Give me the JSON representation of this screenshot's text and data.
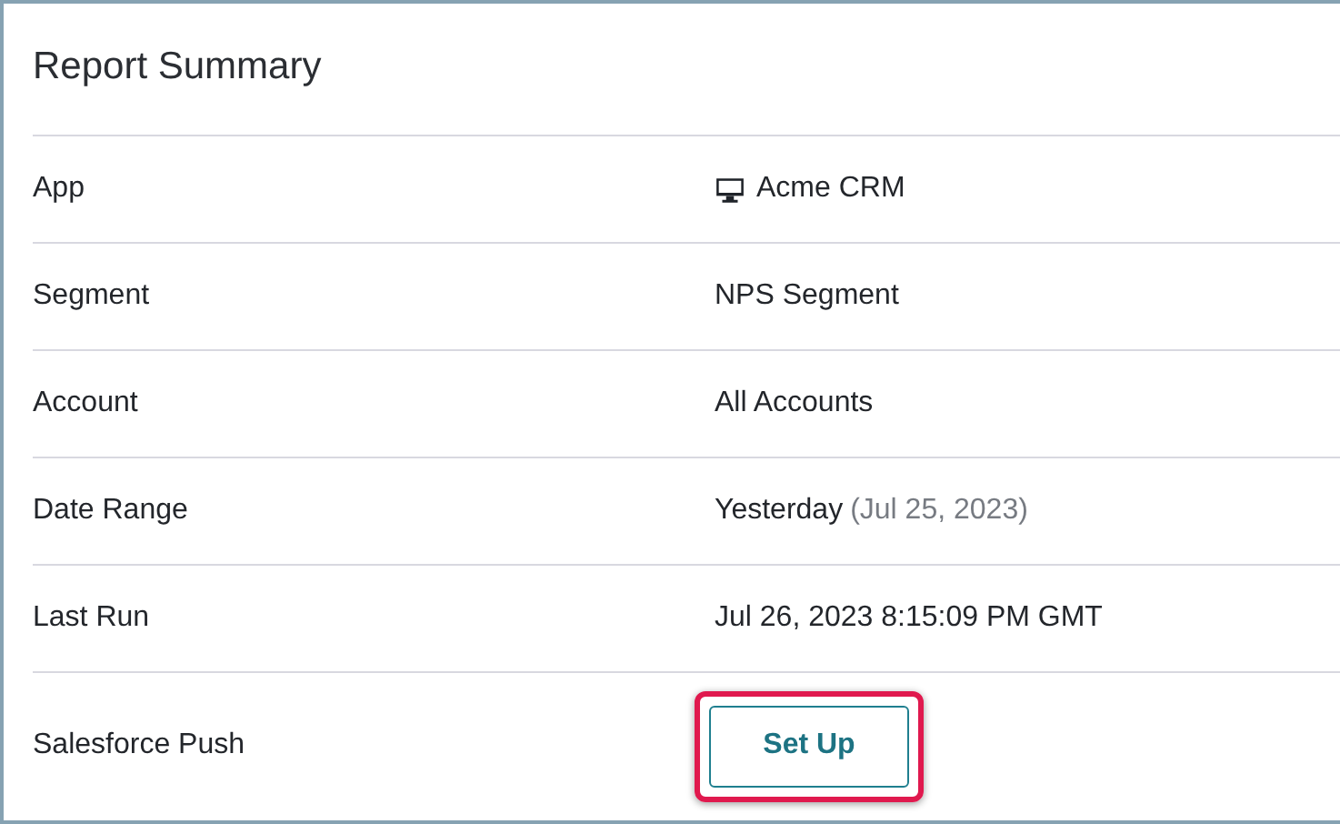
{
  "panel": {
    "title": "Report Summary"
  },
  "rows": [
    {
      "label": "App",
      "kind": "app",
      "value": "Acme CRM"
    },
    {
      "label": "Segment",
      "kind": "text",
      "value": "NPS Segment"
    },
    {
      "label": "Account",
      "kind": "text",
      "value": "All Accounts"
    },
    {
      "label": "Date Range",
      "kind": "text",
      "value": "Yesterday",
      "note": "(Jul 25, 2023)"
    },
    {
      "label": "Last Run",
      "kind": "text",
      "value": "Jul 26, 2023 8:15:09 PM GMT"
    },
    {
      "label": "Salesforce Push",
      "kind": "button",
      "value": "Set Up",
      "highlighted": true
    }
  ]
}
